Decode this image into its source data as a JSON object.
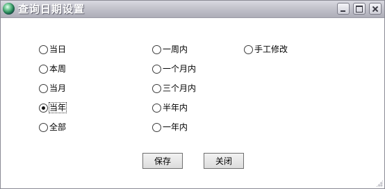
{
  "window": {
    "title": "查询日期设置"
  },
  "options": [
    {
      "id": "today",
      "label": "当日",
      "checked": false
    },
    {
      "id": "this-week",
      "label": "本周",
      "checked": false
    },
    {
      "id": "this-month",
      "label": "当月",
      "checked": false
    },
    {
      "id": "this-year",
      "label": "当年",
      "checked": true
    },
    {
      "id": "all",
      "label": "全部",
      "checked": false
    },
    {
      "id": "one-week",
      "label": "一周内",
      "checked": false
    },
    {
      "id": "one-month",
      "label": "一个月内",
      "checked": false
    },
    {
      "id": "three-months",
      "label": "三个月内",
      "checked": false
    },
    {
      "id": "half-year",
      "label": "半年内",
      "checked": false
    },
    {
      "id": "one-year",
      "label": "一年内",
      "checked": false
    },
    {
      "id": "manual",
      "label": "手工修改",
      "checked": false
    }
  ],
  "buttons": {
    "save_label": "保存",
    "close_label": "关闭"
  }
}
